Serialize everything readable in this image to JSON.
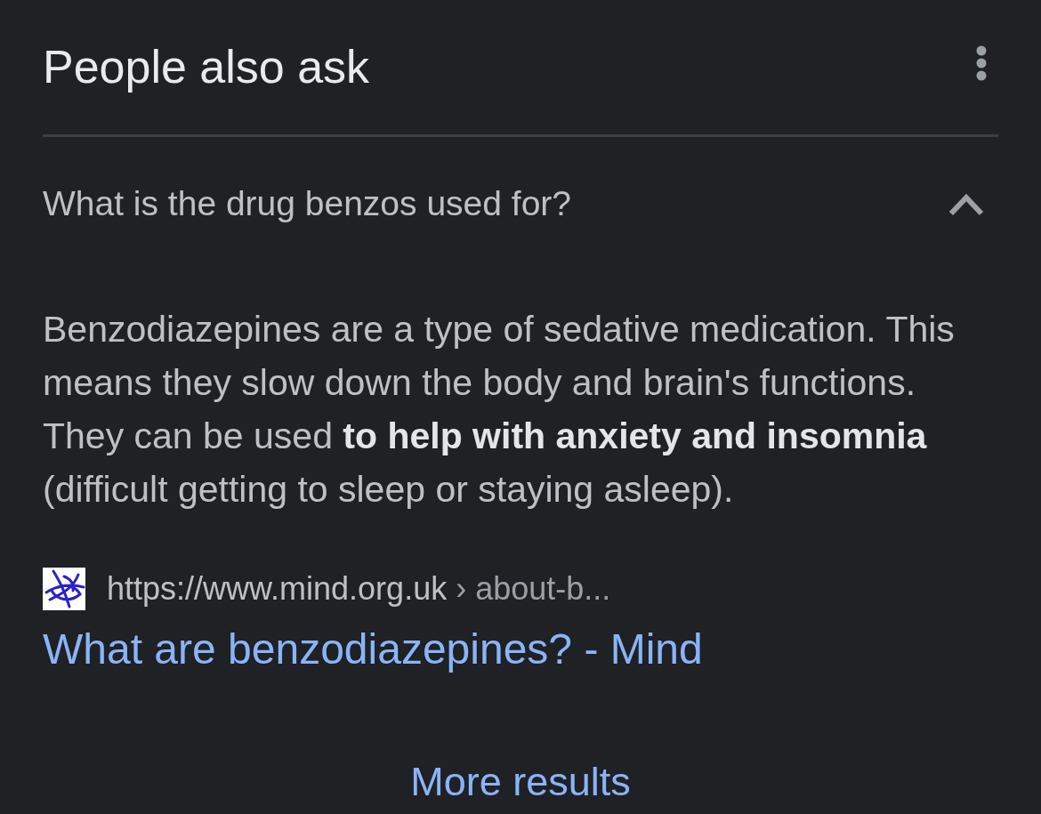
{
  "header": {
    "title": "People also ask"
  },
  "questions": [
    {
      "question": "What is the drug benzos used for?",
      "expanded": true,
      "answer": "Benzodiazepines are a type of sedative medication. This means they slow down the body and brain's functions. They can be used **to help with anxiety and insomnia** (difficult getting to sleep or staying asleep).",
      "source": {
        "url": "https://www.mind.org.uk",
        "path": "› about-b...",
        "title": "What are benzodiazepines? - Mind"
      }
    }
  ],
  "more_results": "More results"
}
